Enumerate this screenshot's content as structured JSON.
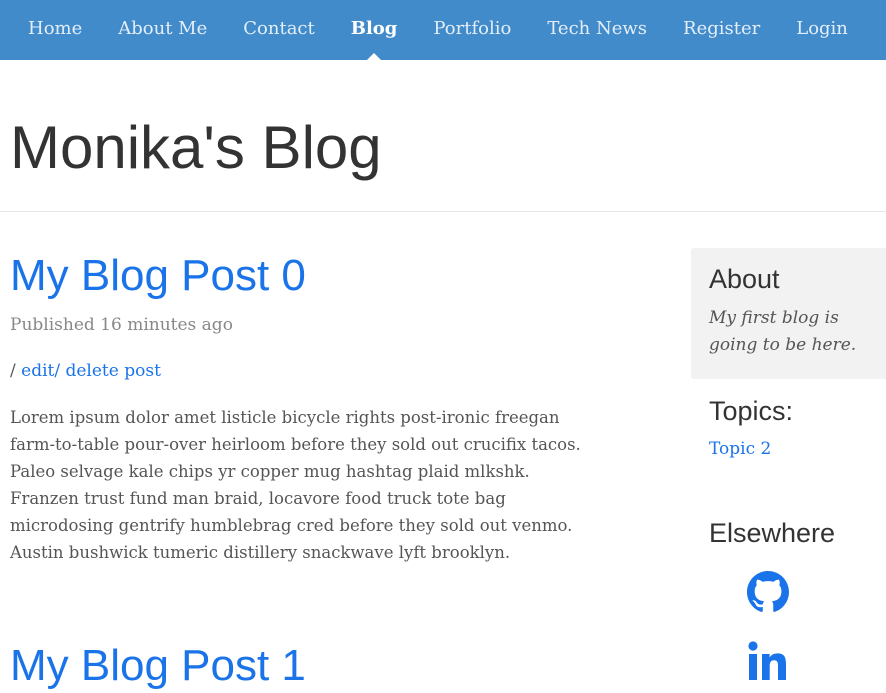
{
  "nav": {
    "items": [
      {
        "label": "Home",
        "active": false
      },
      {
        "label": "About Me",
        "active": false
      },
      {
        "label": "Contact",
        "active": false
      },
      {
        "label": "Blog",
        "active": true
      },
      {
        "label": "Portfolio",
        "active": false
      },
      {
        "label": "Tech News",
        "active": false
      },
      {
        "label": "Register",
        "active": false
      },
      {
        "label": "Login",
        "active": false
      }
    ]
  },
  "header": {
    "title": "Monika's Blog"
  },
  "posts": [
    {
      "title": "My Blog Post 0",
      "published": "Published 16 minutes ago",
      "actions_sep": "/",
      "edit_label": "edit",
      "delete_label": "/ delete post",
      "body": "Lorem ipsum dolor amet listicle bicycle rights post-ironic freegan farm-to-table pour-over heirloom before they sold out crucifix tacos. Paleo selvage kale chips yr copper mug hashtag plaid mlkshk. Franzen trust fund man braid, locavore food truck tote bag microdosing gentrify humblebrag cred before they sold out venmo. Austin bushwick tumeric distillery snackwave lyft brooklyn."
    },
    {
      "title": "My Blog Post 1"
    }
  ],
  "sidebar": {
    "about_heading": "About",
    "about_text": "My first blog is going to be here.",
    "topics_heading": "Topics:",
    "topics": [
      "Topic 2"
    ],
    "elsewhere_heading": "Elsewhere",
    "social": [
      {
        "icon": "github-icon",
        "color": "#1a73e8"
      },
      {
        "icon": "linkedin-icon",
        "color": "#1a73e8"
      }
    ]
  },
  "colors": {
    "navbar": "#428bca",
    "link": "#1a73e8"
  }
}
